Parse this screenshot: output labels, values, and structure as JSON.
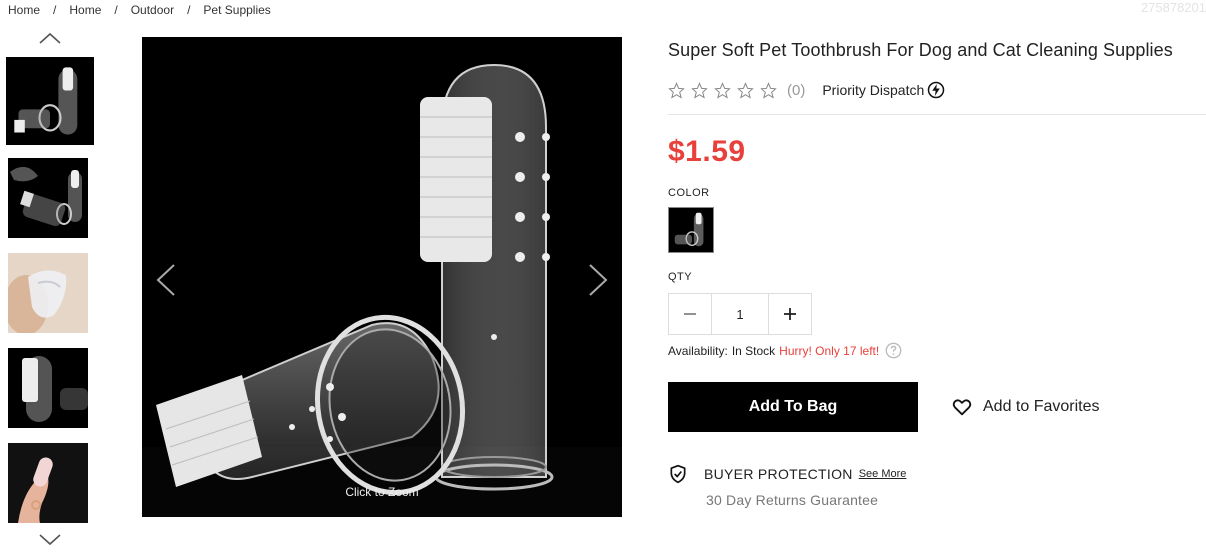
{
  "breadcrumb": {
    "items": [
      "Home",
      "Home",
      "Outdoor",
      "Pet Supplies"
    ],
    "separator": "/"
  },
  "product_id": "275878201",
  "gallery": {
    "thumbnail_count": 5,
    "zoom_hint": "Click to Zoom"
  },
  "product": {
    "title": "Super Soft Pet Toothbrush For Dog and Cat Cleaning Supplies",
    "rating": 0,
    "rating_max": 5,
    "review_count": "(0)",
    "dispatch_label": "Priority Dispatch",
    "price": "$1.59",
    "color_label": "COLOR",
    "qty_label": "QTY",
    "qty_value": "1",
    "availability_label": "Availability:",
    "availability_status": "In Stock",
    "stock_warning": "Hurry! Only 17 left!",
    "add_to_bag": "Add To Bag",
    "add_to_favorites": "Add to Favorites",
    "protection_label": "BUYER PROTECTION",
    "see_more": "See More",
    "guarantee": "30 Day Returns Guarantee"
  },
  "colors": {
    "price": "#e8413c",
    "button_bg": "#000000",
    "stock_warning": "#e8413c"
  },
  "icons": [
    "chevron-up-icon",
    "chevron-down-icon",
    "chevron-left-icon",
    "chevron-right-icon",
    "star-outline-icon",
    "lightning-icon",
    "minus-icon",
    "plus-icon",
    "question-icon",
    "heart-icon",
    "shield-check-icon"
  ]
}
